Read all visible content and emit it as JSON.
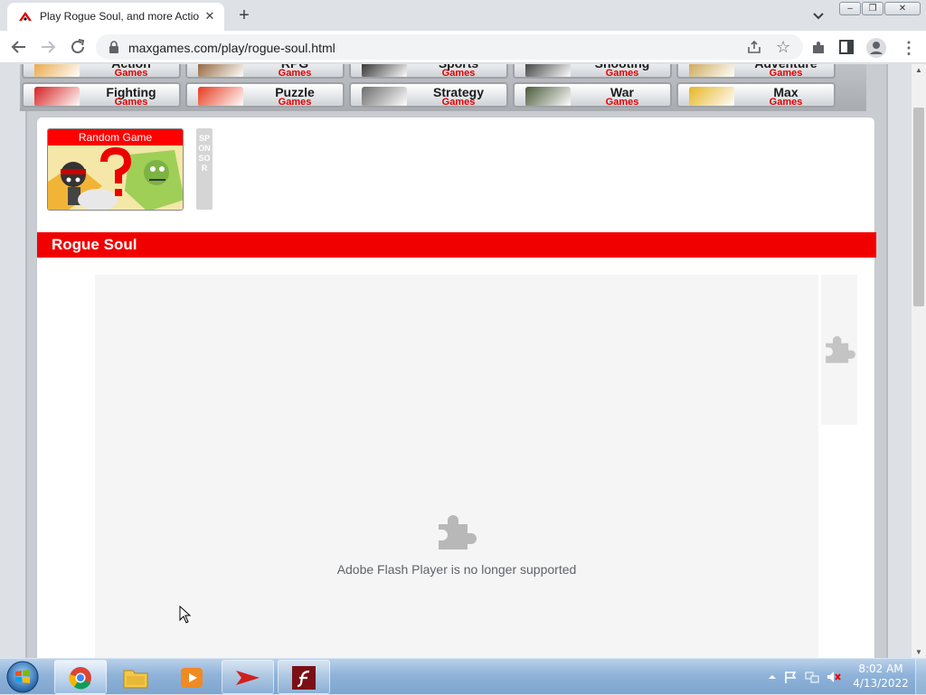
{
  "browser": {
    "tab_title": "Play Rogue Soul, and more Actio",
    "tab_close": "✕",
    "new_tab": "+",
    "url": "maxgames.com/play/rogue-soul.html",
    "star": "☆",
    "menu": "⋮",
    "window_min": "–",
    "window_max": "❐",
    "window_close": "✕"
  },
  "categories": [
    {
      "name": "Action",
      "sub": "Games",
      "row": 1,
      "icon": "action-icon",
      "color": "#e7a23a"
    },
    {
      "name": "RPG",
      "sub": "Games",
      "row": 1,
      "icon": "rpg-icon",
      "color": "#8b5a2b"
    },
    {
      "name": "Sports",
      "sub": "Games",
      "row": 1,
      "icon": "soccer-ball-icon",
      "color": "#222222"
    },
    {
      "name": "Shooting",
      "sub": "Games",
      "row": 1,
      "icon": "gun-icon",
      "color": "#333333"
    },
    {
      "name": "Adventure",
      "sub": "Games",
      "row": 1,
      "icon": "treasure-icon",
      "color": "#c9a24b"
    },
    {
      "name": "Fighting",
      "sub": "Games",
      "row": 2,
      "icon": "boxing-glove-icon",
      "color": "#d62020"
    },
    {
      "name": "Puzzle",
      "sub": "Games",
      "row": 2,
      "icon": "puzzle-icon",
      "color": "#e53b1f"
    },
    {
      "name": "Strategy",
      "sub": "Games",
      "row": 2,
      "icon": "crossed-swords-icon",
      "color": "#6e6e6e"
    },
    {
      "name": "War",
      "sub": "Games",
      "row": 2,
      "icon": "tank-icon",
      "color": "#4a5a3a"
    },
    {
      "name": "Max",
      "sub": "Games",
      "row": 2,
      "icon": "crown-icon",
      "color": "#e6b422"
    }
  ],
  "random_game": {
    "label": "Random Game"
  },
  "sponsor": {
    "text": "SPONSOR"
  },
  "game": {
    "title": "Rogue Soul",
    "flash_message": "Adobe Flash Player is no longer supported"
  },
  "taskbar": {
    "items": [
      "chrome",
      "windows-explorer",
      "media-player",
      "arrow-app",
      "adobe-flash"
    ],
    "clock_time": "8:02 AM",
    "clock_date": "4/13/2022"
  },
  "colors": {
    "brand_red": "#f10000",
    "category_sub": "#e00000"
  }
}
